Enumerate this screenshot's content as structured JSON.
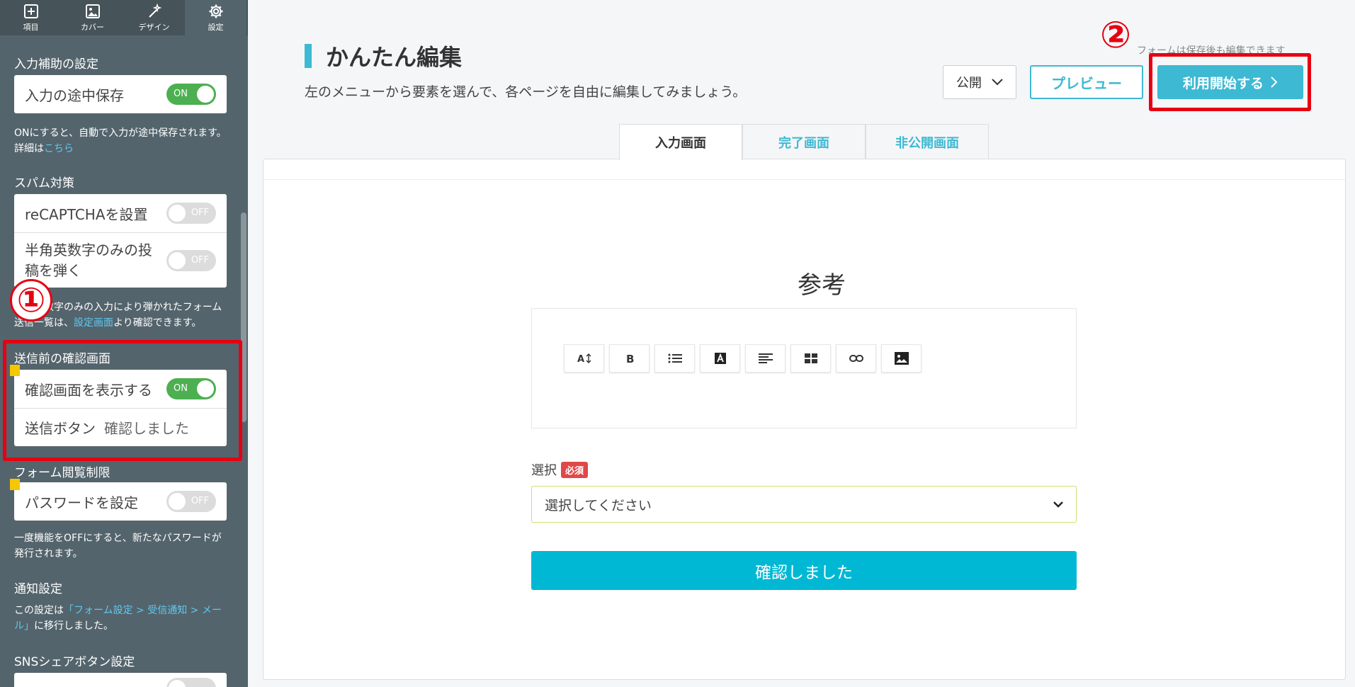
{
  "sidebar": {
    "tabs": [
      {
        "label": "項目",
        "icon": "plus-square-icon"
      },
      {
        "label": "カバー",
        "icon": "image-icon"
      },
      {
        "label": "デザイン",
        "icon": "magic-wand-icon"
      },
      {
        "label": "設定",
        "icon": "gear-icon"
      }
    ],
    "input_assist": {
      "title": "入力補助の設定",
      "autosave_label": "入力の途中保存",
      "autosave_state": "ON",
      "note_prefix": "ONにすると、自動で入力が途中保存されます。詳細は",
      "note_link": "こちら"
    },
    "spam": {
      "title": "スパム対策",
      "recaptcha_label": "reCAPTCHAを設置",
      "recaptcha_state": "OFF",
      "alnum_label": "半角英数字のみの投稿を弾く",
      "alnum_state": "OFF",
      "note_prefix": "半角英数字のみの入力により弾かれたフォーム送信一覧は、",
      "note_link": "設定画面",
      "note_suffix": "より確認できます。"
    },
    "confirm": {
      "title": "送信前の確認画面",
      "show_label": "確認画面を表示する",
      "show_state": "ON",
      "button_label": "送信ボタン",
      "button_value": "確認しました"
    },
    "access": {
      "title": "フォーム閲覧制限",
      "password_label": "パスワードを設定",
      "password_state": "OFF",
      "note": "一度機能をOFFにすると、新たなパスワードが発行されます。"
    },
    "notify": {
      "title": "通知設定",
      "note_prefix": "この設定は",
      "note_link": "「フォーム設定 > 受信通知 > メール」",
      "note_suffix": "に移行しました。"
    },
    "sns": {
      "title": "SNSシェアボタン設定"
    }
  },
  "annotations": {
    "marker1": "①",
    "marker2": "②",
    "highlight_color": "#e60012"
  },
  "header": {
    "title": "かんたん編集",
    "subtitle": "左のメニューから要素を選んで、各ページを自由に編集してみましょう。",
    "save_note": "フォームは保存後も編集できます",
    "publish_value": "公開",
    "preview_label": "プレビュー",
    "start_label": "利用開始する"
  },
  "page_tabs": [
    {
      "label": "入力画面",
      "active": true
    },
    {
      "label": "完了画面",
      "active": false
    },
    {
      "label": "非公開画面",
      "active": false
    }
  ],
  "form": {
    "heading": "参考",
    "toolbar": [
      "font-size-icon",
      "bold-icon",
      "list-icon",
      "text-color-icon",
      "align-icon",
      "table-icon",
      "link-icon",
      "image-icon"
    ],
    "field_label": "選択",
    "required_badge": "必須",
    "select_placeholder": "選択してください",
    "confirm_button": "確認しました"
  },
  "colors": {
    "accent": "#3db9d3",
    "sidebar_bg": "#54646c",
    "toggle_on": "#4caf50",
    "submit": "#00b8d4"
  }
}
